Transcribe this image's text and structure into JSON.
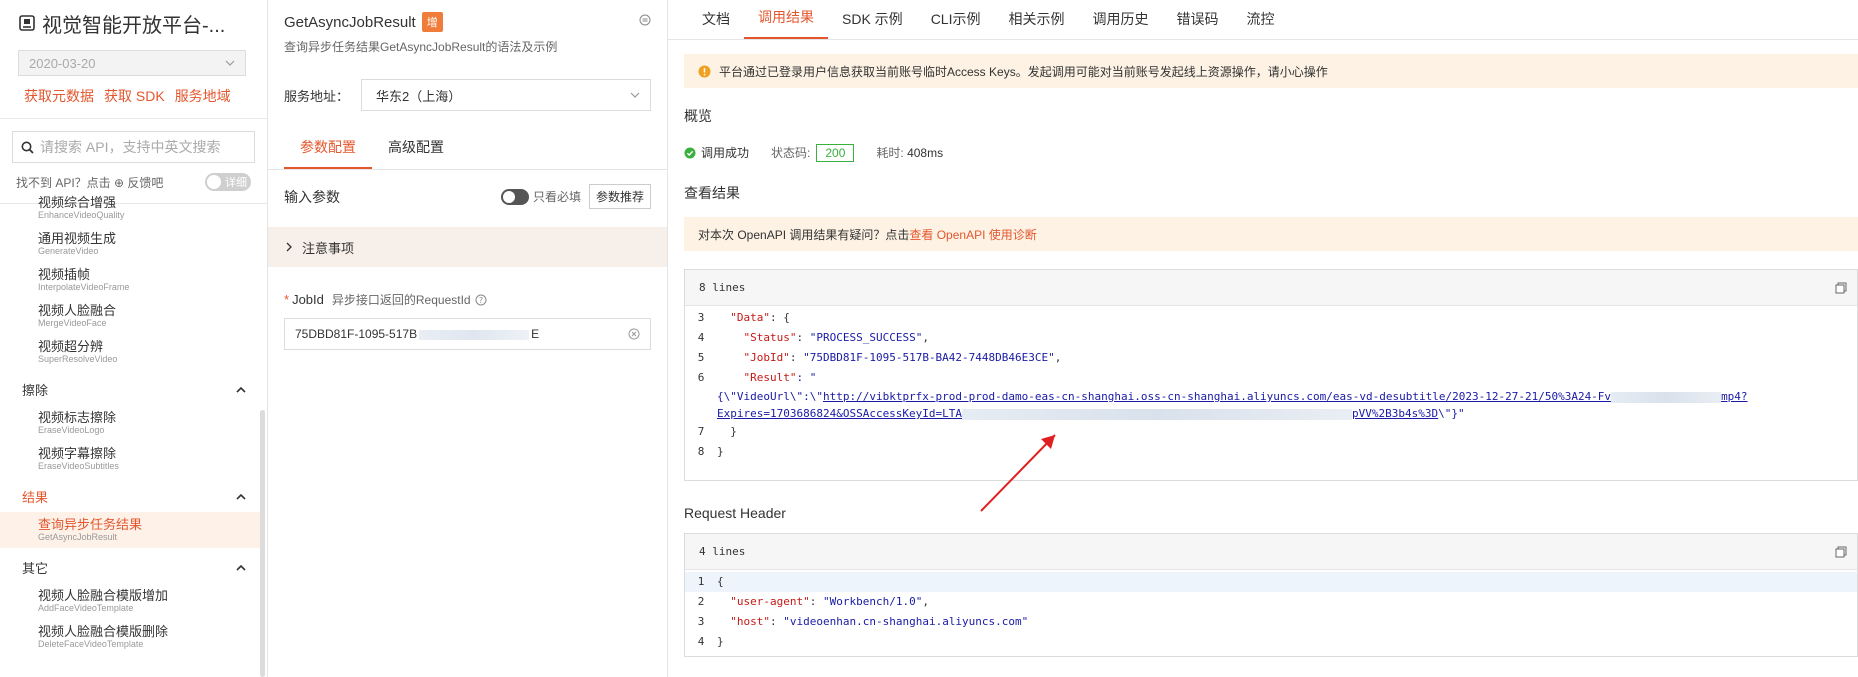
{
  "sidebar": {
    "app_title": "视觉智能开放平台-...",
    "date_value": "2020-03-20",
    "links": [
      "获取元数据",
      "获取 SDK",
      "服务地域"
    ],
    "search_placeholder": "请搜索 API，支持中英文搜索",
    "help_text": "找不到 API？点击 ⊕ 反馈吧",
    "detail_toggle": "详细",
    "nav": {
      "items_top": [
        {
          "zh": "视频综合增强",
          "en": "EnhanceVideoQuality"
        },
        {
          "zh": "通用视频生成",
          "en": "GenerateVideo"
        },
        {
          "zh": "视频插帧",
          "en": "InterpolateVideoFrame"
        },
        {
          "zh": "视频人脸融合",
          "en": "MergeVideoFace"
        },
        {
          "zh": "视频超分辨",
          "en": "SuperResolveVideo"
        }
      ],
      "group_erase": "擦除",
      "items_erase": [
        {
          "zh": "视频标志擦除",
          "en": "EraseVideoLogo"
        },
        {
          "zh": "视频字幕擦除",
          "en": "EraseVideoSubtitles"
        }
      ],
      "group_result": "结果",
      "item_result": {
        "zh": "查询异步任务结果",
        "en": "GetAsyncJobResult"
      },
      "group_other": "其它",
      "items_other": [
        {
          "zh": "视频人脸融合模版增加",
          "en": "AddFaceVideoTemplate"
        },
        {
          "zh": "视频人脸融合模版删除",
          "en": "DeleteFaceVideoTemplate"
        }
      ]
    }
  },
  "mid": {
    "api_name": "GetAsyncJobResult",
    "badge": "增",
    "subtitle": "查询异步任务结果GetAsyncJobResult的语法及示例",
    "service_label": "服务地址：",
    "service_value": "华东2（上海）",
    "tabs": [
      "参数配置",
      "高级配置"
    ],
    "input_params_label": "输入参数",
    "required_only_label": "只看必填",
    "recommend_button": "参数推荐",
    "notice_label": "注意事项",
    "jobid_label": "JobId",
    "jobid_desc": "异步接口返回的RequestId",
    "jobid_value_prefix": "75DBD81F-1095-517B",
    "jobid_value_suffix": "E"
  },
  "right": {
    "tabs": [
      "文档",
      "调用结果",
      "SDK 示例",
      "CLI示例",
      "相关示例",
      "调用历史",
      "错误码",
      "流控"
    ],
    "warning": "平台通过已登录用户信息获取当前账号临时Access Keys。发起调用可能对当前账号发起线上资源操作，请小心操作",
    "overview_title": "概览",
    "status_ok": "调用成功",
    "status_code_label": "状态码:",
    "status_code": "200",
    "elapsed_label": "耗时:",
    "elapsed": "408ms",
    "result_title": "查看结果",
    "diag_prefix": "对本次 OpenAPI 调用结果有疑问？点击",
    "diag_link": "查看 OpenAPI 使用诊断",
    "result_block": {
      "lines_label": "8 lines",
      "line3": [
        "3",
        "\"Data\"",
        ": {"
      ],
      "line4": [
        "4",
        "\"Status\"",
        ": ",
        "\"PROCESS_SUCCESS\"",
        ","
      ],
      "line5": [
        "5",
        "\"JobId\"",
        ": ",
        "\"75DBD81F-1095-517B-BA42-7448DB46E3CE\"",
        ","
      ],
      "line6": [
        "6",
        "\"Result\"",
        ": \""
      ],
      "wrap_a": "{\\\"VideoUrl\\\":\\\"",
      "url_a": "http://vibktprfx-prod-prod-damo-eas-cn-shanghai.oss-cn-shanghai.aliyuncs.com/eas-vd-desubtitle/2023-12-27-21/50%3A24-Fv",
      "url_b": "mp4?",
      "url_c": "Expires=1703686824&OSSAccessKeyId=LTA",
      "url_d": "pVV%2B3b4s%3D",
      "wrap_end": "\\\"}\"",
      "line7": [
        "7",
        "}"
      ],
      "line8": [
        "8",
        "}"
      ]
    },
    "header_title": "Request Header",
    "header_block": {
      "lines_label": "4 lines",
      "line1": [
        "1",
        "{"
      ],
      "line2": [
        "2",
        "\"user-agent\"",
        ": ",
        "\"Workbench/1.0\"",
        ","
      ],
      "line3": [
        "3",
        "\"host\"",
        ": ",
        "\"videoenhan.cn-shanghai.aliyuncs.com\""
      ],
      "line4": [
        "4",
        "}"
      ]
    }
  },
  "colors": {
    "accent": "#e4572e",
    "success": "#3ab03e",
    "warn_bg": "#fdf2e4"
  }
}
